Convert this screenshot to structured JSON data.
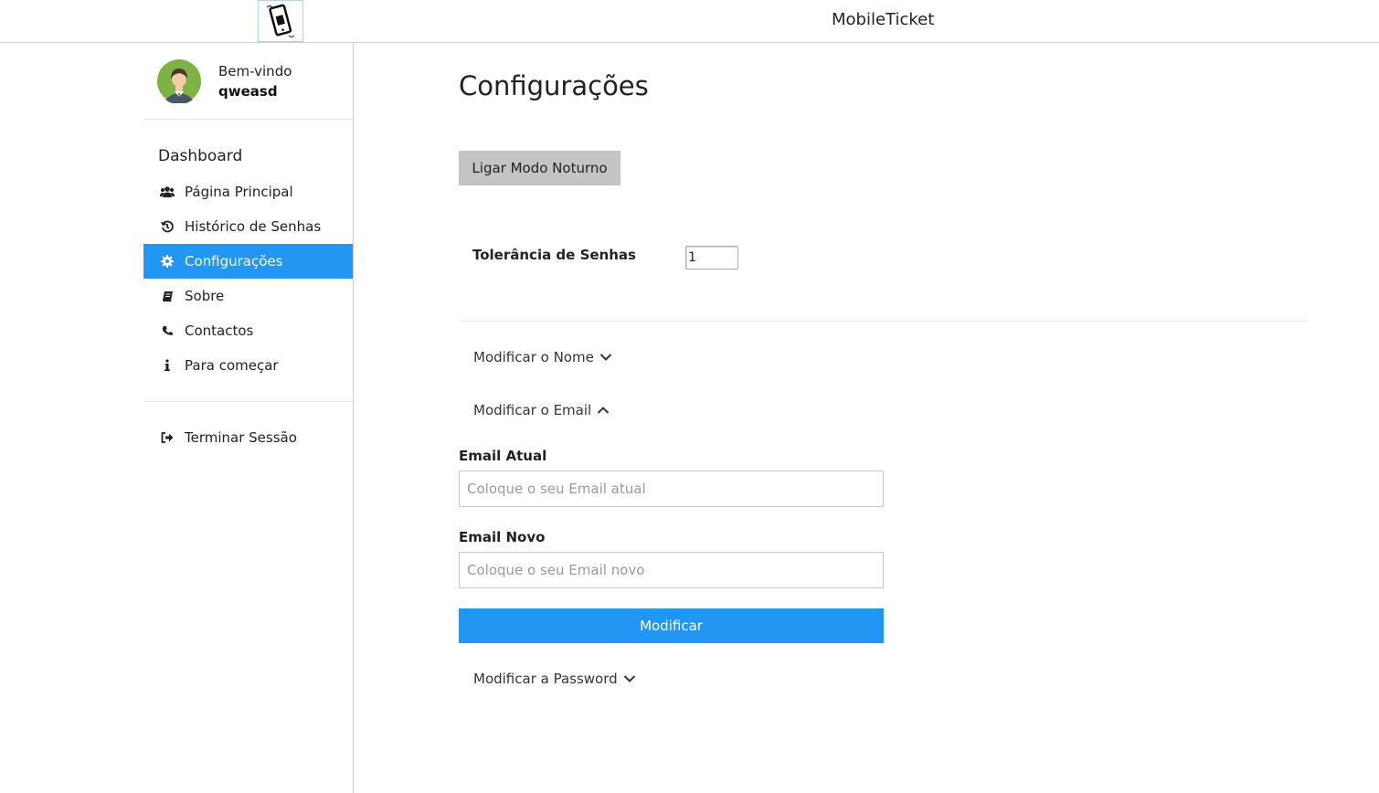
{
  "header": {
    "app_title": "MobileTicket",
    "logo_icon": "phone-ticket-logo-icon"
  },
  "sidebar": {
    "welcome": "Bem-vindo",
    "username": "qweasd",
    "section_title": "Dashboard",
    "items": [
      {
        "label": "Página Principal",
        "icon": "users-icon"
      },
      {
        "label": "Histórico de Senhas",
        "icon": "history-icon"
      },
      {
        "label": "Configurações",
        "icon": "gear-icon",
        "active": true
      },
      {
        "label": "Sobre",
        "icon": "book-icon"
      },
      {
        "label": "Contactos",
        "icon": "phone-icon"
      },
      {
        "label": "Para começar",
        "icon": "info-icon"
      }
    ],
    "logout": {
      "label": "Terminar Sessão",
      "icon": "sign-out-icon"
    }
  },
  "main": {
    "title": "Configurações",
    "night_mode_button": "Ligar Modo Noturno",
    "tolerance": {
      "label": "Tolerância de Senhas",
      "value": "1"
    },
    "accordion": {
      "name": "Modificar o Nome",
      "email": "Modificar o Email",
      "password": "Modificar a Password"
    },
    "email_form": {
      "current_label": "Email Atual",
      "current_placeholder": "Coloque o seu Email atual",
      "new_label": "Email Novo",
      "new_placeholder": "Coloque o seu Email novo",
      "submit": "Modificar"
    }
  },
  "colors": {
    "accent": "#2196f3",
    "night_button": "#c4c4c4"
  }
}
